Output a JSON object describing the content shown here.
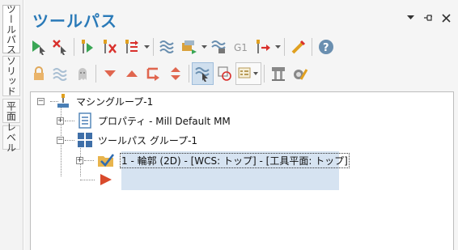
{
  "side_tabs": [
    {
      "label": "ツールパス",
      "active": true
    },
    {
      "label": "ソリッド",
      "active": false
    },
    {
      "label": "平面",
      "active": false
    },
    {
      "label": "レベル",
      "active": false
    }
  ],
  "panel": {
    "title": "ツールパス",
    "controls": [
      "pin-dropdown-icon",
      "auto-hide-pin-icon",
      "close-icon"
    ]
  },
  "toolbar_row1": [
    "select-all-toolpaths",
    "deselect-toolpaths",
    "regenerate-selected",
    "regenerate-dirty",
    "toggle-posting",
    "backplot",
    "verify",
    "simulate",
    "g1-post",
    "post-output",
    "highlight-tool",
    "help"
  ],
  "toolbar_row2": [
    "lock",
    "toggle-display",
    "ghost",
    "move-down",
    "move-up",
    "insert-arrow",
    "expand-collapse",
    "only-display-selected",
    "show-selected-entity",
    "display-options",
    "tool-manager",
    "material-manager"
  ],
  "tree": {
    "machine_group": "マシングループ-1",
    "properties": "プロパティ - Mill Default MM",
    "toolpath_group": "ツールパス グループ-1",
    "operation": "1 - 輪郭 (2D) - [WCS: トップ] - [工具平面: トップ]"
  },
  "colors": {
    "title": "#2a7ab8",
    "selection": "#d6e3f1",
    "insert_arrow": "#d94a2b"
  }
}
